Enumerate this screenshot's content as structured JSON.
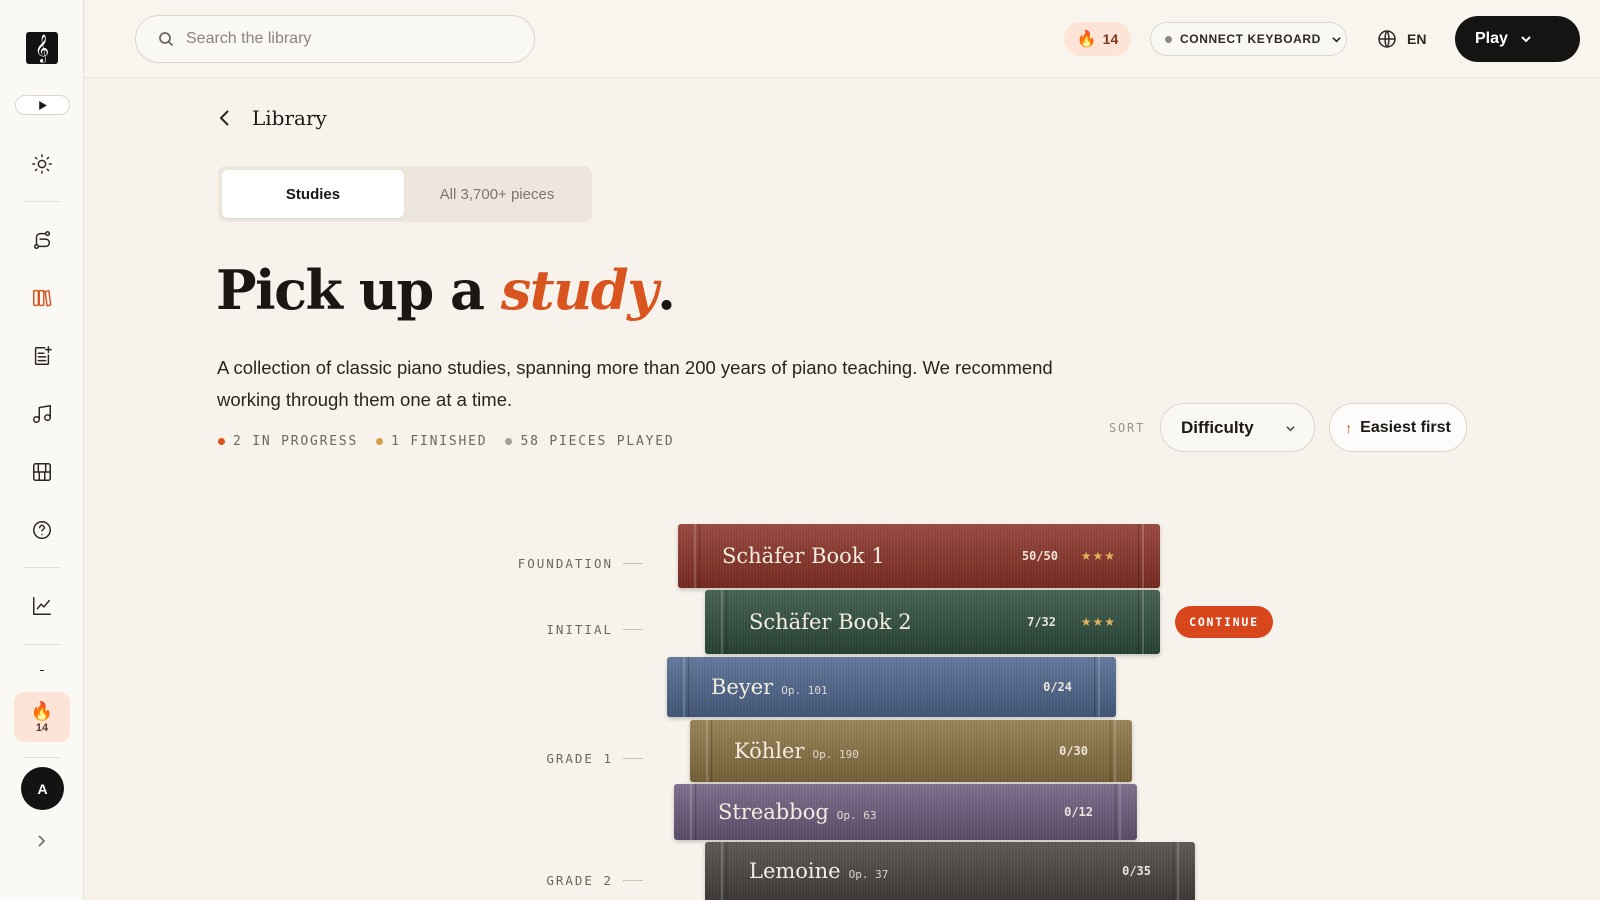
{
  "sidebar": {
    "logo_glyph": "𝄞",
    "streak_count": "14",
    "avatar_initial": "A"
  },
  "topbar": {
    "search_placeholder": "Search the library",
    "streak_count": "14",
    "keyboard_label": "CONNECT KEYBOARD",
    "language": "EN",
    "play_label": "Play"
  },
  "page": {
    "breadcrumb": "Library",
    "tabs": [
      {
        "label": "Studies"
      },
      {
        "label": "All 3,700+ pieces"
      }
    ],
    "headline_prefix": "Pick up a ",
    "headline_em": "study",
    "headline_suffix": ".",
    "description": "A collection of classic piano studies, spanning more than 200 years of piano teaching. We recommend working through them one at a time.",
    "stats": [
      {
        "label": "2 IN PROGRESS",
        "color": "#d9541f"
      },
      {
        "label": "1 FINISHED",
        "color": "#d1a14a"
      },
      {
        "label": "58 PIECES PLAYED",
        "color": "#a49d93"
      }
    ],
    "sort": {
      "label": "SORT",
      "value": "Difficulty",
      "direction": "Easiest first"
    }
  },
  "levels": [
    "FOUNDATION",
    "INITIAL",
    "GRADE 1",
    "GRADE 2"
  ],
  "books": [
    {
      "title": "Schäfer Book 1",
      "op": "",
      "count": "50/50",
      "stars": "★★★",
      "color": "#8e3328"
    },
    {
      "title": "Schäfer Book 2",
      "op": "",
      "count": "7/32",
      "stars": "★★★",
      "color": "#2f4f3f"
    },
    {
      "title": "Beyer",
      "op": "Op. 101",
      "count": "0/24",
      "stars": "",
      "color": "#4f6890"
    },
    {
      "title": "Köhler",
      "op": "Op. 190",
      "count": "0/30",
      "stars": "",
      "color": "#8e7544"
    },
    {
      "title": "Streabbog",
      "op": "Op. 63",
      "count": "0/12",
      "stars": "",
      "color": "#6f5c7f"
    },
    {
      "title": "Lemoine",
      "op": "Op. 37",
      "count": "0/35",
      "stars": "",
      "color": "#4b4541"
    }
  ],
  "continue_label": "CONTINUE"
}
